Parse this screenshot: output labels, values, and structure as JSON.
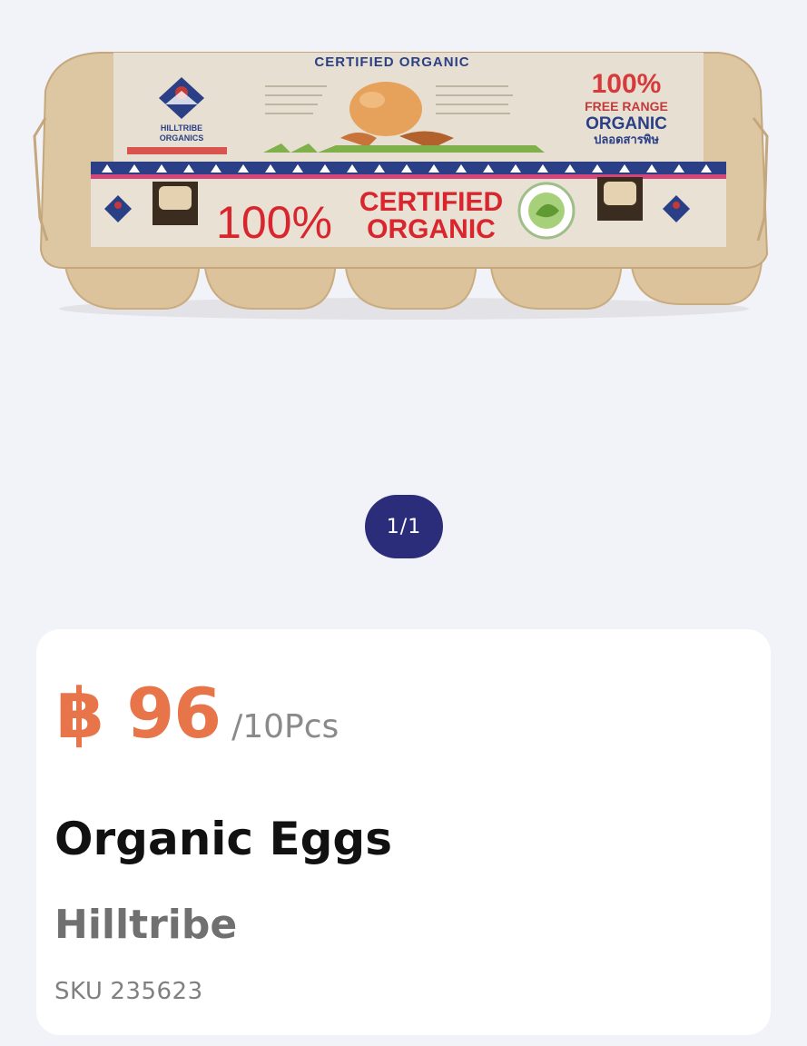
{
  "gallery": {
    "pager": "1/1",
    "image": {
      "top_text": "CERTIFIED ORGANIC",
      "badge_line1": "100%",
      "badge_line2": "FREE RANGE",
      "badge_line3": "ORGANIC",
      "badge_line4": "ปลอดสารพิษ",
      "banner_100": "100%",
      "banner_certified": "CERTIFIED",
      "banner_organic": "ORGANIC",
      "logo_line1": "HILLTRIBE",
      "logo_line2": "ORGANICS"
    }
  },
  "product": {
    "price": "฿ 96",
    "unit": "/10Pcs",
    "name": "Organic Eggs",
    "brand": "Hilltribe",
    "sku_label": "SKU",
    "sku_value": "235623"
  },
  "colors": {
    "background": "#f2f3f9",
    "price": "#e8754a",
    "pager_bg": "#2b2d7a",
    "card_bg": "#ffffff"
  }
}
